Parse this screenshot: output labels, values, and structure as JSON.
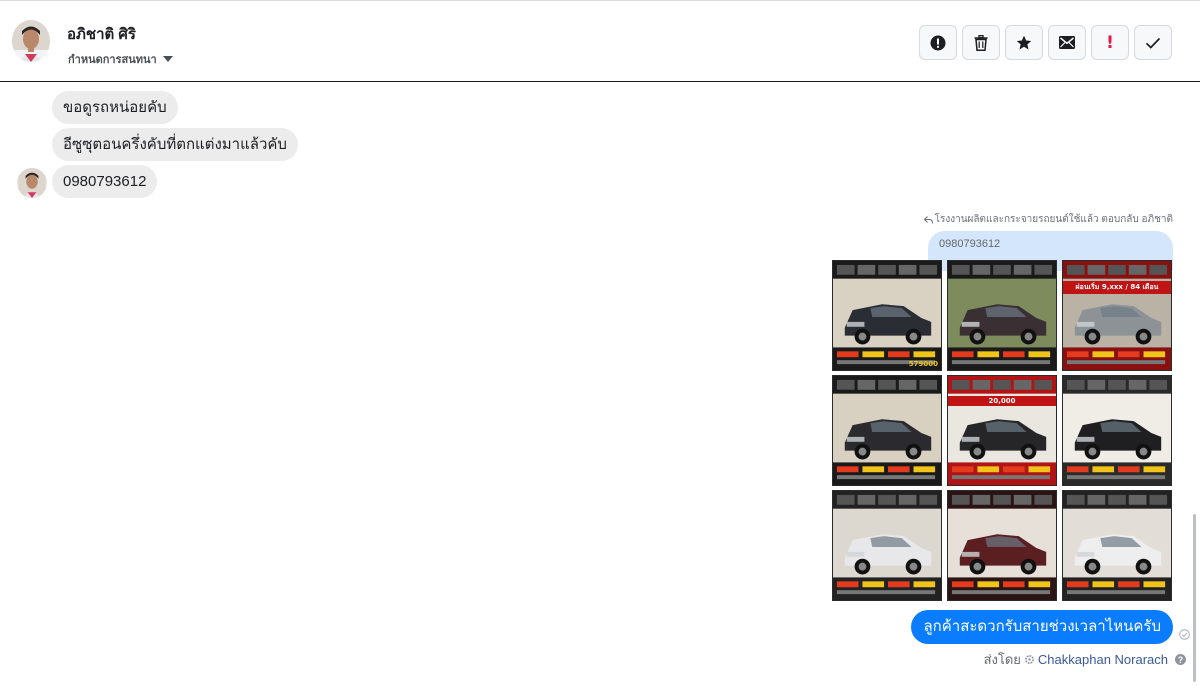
{
  "header": {
    "contact_name": "อภิชาติ ศิริ",
    "assign_label": "กำหนดการสนทนา"
  },
  "toolbar": {
    "buttons": [
      {
        "name": "spam",
        "icon": "alert-circle-icon"
      },
      {
        "name": "delete",
        "icon": "trash-icon"
      },
      {
        "name": "star",
        "icon": "star-icon"
      },
      {
        "name": "unread",
        "icon": "envelope-icon"
      },
      {
        "name": "follow-up",
        "icon": "exclamation-icon",
        "label": "!"
      },
      {
        "name": "done",
        "icon": "checkmark-icon"
      }
    ]
  },
  "messages": {
    "incoming": [
      {
        "text": "ขอดูรถหน่อยคับ"
      },
      {
        "text": "อีซูซุตอนครึ่งคับที่ตกแต่งมาแล้วคับ"
      },
      {
        "text": "0980793612"
      }
    ],
    "reply": {
      "replied_note": "โรงงานผลิตและกระจายรถยนต์ใช้แล้ว ตอบกลับ อภิชาติ",
      "quoted_text": "0980793612"
    },
    "image_tiles": [
      {
        "tag": "",
        "price": "579000"
      },
      {
        "tag": "",
        "price": ""
      },
      {
        "tag": "ผ่อนเริ่ม 9,xxx / 84 เดือน",
        "price": ""
      },
      {
        "tag": "",
        "price": ""
      },
      {
        "tag": "20,000",
        "price": ""
      },
      {
        "tag": "",
        "price": ""
      },
      {
        "tag": "",
        "price": ""
      },
      {
        "tag": "",
        "price": ""
      },
      {
        "tag": "",
        "price": ""
      }
    ],
    "outgoing": {
      "text": "ลูกค้าสะดวกรับสายช่วงเวลาไหนครับ"
    },
    "sent_by_label": "ส่งโดย",
    "agent_name": "Chakkaphan Norarach"
  },
  "colors": {
    "outgoing_bubble": "#0a7cff",
    "incoming_bubble": "#ececec",
    "quote_bubble": "#d3e6fc",
    "accent_red": "#e4174a"
  }
}
